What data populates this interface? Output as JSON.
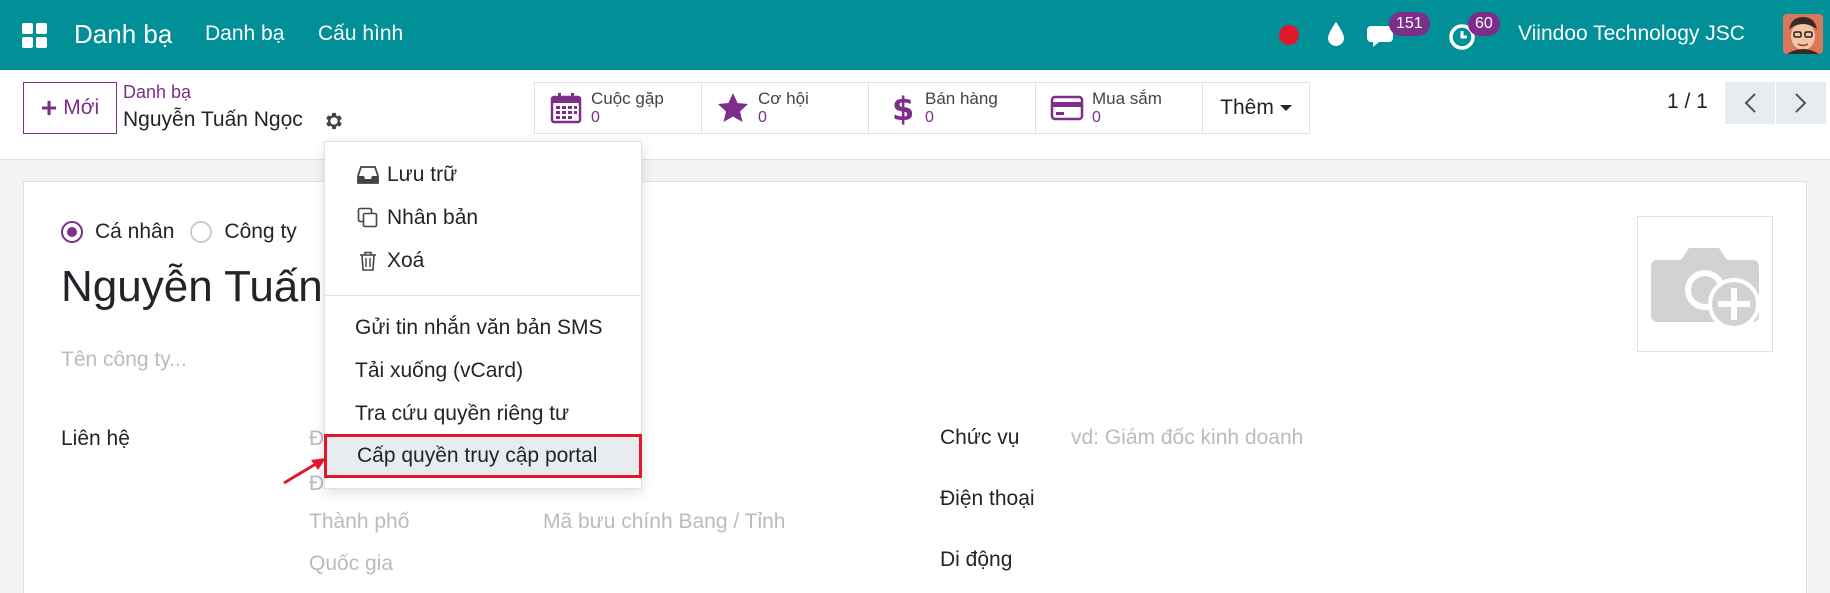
{
  "navbar": {
    "brand": "Danh bạ",
    "menu": [
      "Danh bạ",
      "Cấu hình"
    ],
    "chat_count": "151",
    "activity_count": "60",
    "company": "Viindoo Technology JSC"
  },
  "control": {
    "new_label": "Mới",
    "breadcrumb_parent": "Danh bạ",
    "breadcrumb_current": "Nguyễn Tuấn Ngọc",
    "smart_buttons": [
      {
        "label": "Cuộc gặp",
        "value": "0",
        "icon": "calendar-icon"
      },
      {
        "label": "Cơ hội",
        "value": "0",
        "icon": "star-icon"
      },
      {
        "label": "Bán hàng",
        "value": "0",
        "icon": "dollar-icon"
      },
      {
        "label": "Mua sắm",
        "value": "0",
        "icon": "credit-card-icon"
      }
    ],
    "more_label": "Thêm",
    "pager": "1 / 1"
  },
  "form": {
    "type_individual": "Cá nhân",
    "type_company": "Công ty",
    "name_partial": "Nguyễn Tuấn",
    "company_placeholder": "Tên công ty...",
    "contact_label": "Liên hệ",
    "street_partial": "Đ",
    "street2_partial": "Đ",
    "city_placeholder": "Thành phố",
    "zip_state_placeholder": "Mã bưu chính Bang / Tỉnh",
    "country_placeholder": "Quốc gia",
    "job_label": "Chức vụ",
    "job_placeholder": "vd: Giám đốc kinh doanh",
    "phone_label": "Điện thoại",
    "mobile_label": "Di động"
  },
  "dropdown": {
    "archive": "Lưu trữ",
    "duplicate": "Nhân bản",
    "delete": "Xoá",
    "send_sms": "Gửi tin nhắn văn bản SMS",
    "download_vcard": "Tải xuống (vCard)",
    "privacy_lookup": "Tra cứu quyền riêng tư",
    "grant_portal": "Cấp quyền truy cập portal"
  },
  "colors": {
    "navbar": "#018f98",
    "accent": "#7c2e8a",
    "highlight_border": "#e0182d"
  }
}
